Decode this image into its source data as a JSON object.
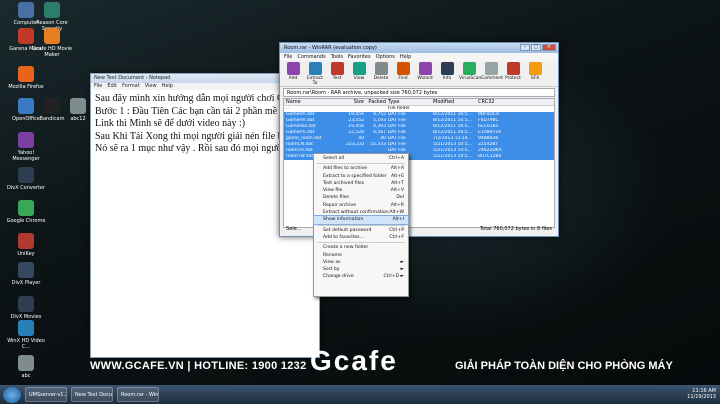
{
  "desktop_icons": [
    {
      "label": "Computer",
      "color": "#4a6fa5"
    },
    {
      "label": "Reason Core Security",
      "color": "#2e7d6b"
    },
    {
      "label": "Garena Menu",
      "color": "#c0392b"
    },
    {
      "label": "Gcafe HD Movie Maker",
      "color": "#e67e22"
    },
    {
      "label": "Mozilla Firefox",
      "color": "#e8641b"
    },
    {
      "label": "OpenOffice",
      "color": "#3a7ac0"
    },
    {
      "label": "Bandicam",
      "color": "#222222"
    },
    {
      "label": "abc12",
      "color": "#7f8c8d"
    },
    {
      "label": "Yahoo! Messenger",
      "color": "#7b3fa0"
    },
    {
      "label": "DivX Converter",
      "color": "#2c3e50"
    },
    {
      "label": "Google Chrome",
      "color": "#3aa757"
    },
    {
      "label": "UniKey",
      "color": "#b03a2e"
    },
    {
      "label": "DivX Player",
      "color": "#34495e"
    },
    {
      "label": "DivX Movies",
      "color": "#2c3e50"
    },
    {
      "label": "WinX HD Video C...",
      "color": "#2980b9"
    },
    {
      "label": "abc",
      "color": "#7f8c8d"
    }
  ],
  "banner": {
    "left": "WWW.GCAFE.VN  |  HOTLINE: 1900 1232",
    "right": "GIẢI PHÁP TOÀN DIỆN CHO PHÒNG MÁY",
    "brand": "Gcafe"
  },
  "notepad": {
    "title": "New Text Document - Notepad",
    "menu": [
      "File",
      "Edit",
      "Format",
      "View",
      "Help"
    ],
    "lines": [
      "Sau đây mình xin hướng dẫn mọi người chơi G",
      "Bước 1 : Đầu Tiên Các bạn cần tải 2 phần mề",
      "Link thì Mình sẽ để dưới video này :)",
      "Sau Khi Tải Xong thì mọi người giải nén file b",
      "Nó sẽ ra 1 mục như vậy . Rồi sau đó mọi người"
    ]
  },
  "winrar": {
    "title": "Room.rar - WinRAR (evaluation copy)",
    "menu": [
      "File",
      "Commands",
      "Tools",
      "Favorites",
      "Options",
      "Help"
    ],
    "toolbar": [
      {
        "label": "Add",
        "color": "#8e44ad"
      },
      {
        "label": "Extract To",
        "color": "#2980b9"
      },
      {
        "label": "Test",
        "color": "#c0392b"
      },
      {
        "label": "View",
        "color": "#16a085"
      },
      {
        "label": "Delete",
        "color": "#7f8c8d"
      },
      {
        "label": "Find",
        "color": "#d35400"
      },
      {
        "label": "Wizard",
        "color": "#8e44ad"
      },
      {
        "label": "Info",
        "color": "#2c3e50"
      },
      {
        "label": "VirusScan",
        "color": "#27ae60"
      },
      {
        "label": "Comment",
        "color": "#95a5a6"
      },
      {
        "label": "Protect",
        "color": "#c0392b"
      },
      {
        "label": "SFX",
        "color": "#f39c12"
      }
    ],
    "path": "Room.rar\\Room - RAR archive, unpacked size 760,072 bytes",
    "columns": [
      "Name",
      "Size",
      "Packed",
      "Type",
      "Modified",
      "CRC32"
    ],
    "rows": [
      {
        "name": "..",
        "size": "",
        "packed": "",
        "type": "File folder",
        "modified": "",
        "crc": "",
        "sel": false
      },
      {
        "name": "Gamerm.dat",
        "size": "19,456",
        "packed": "4,752",
        "type": "DAT File",
        "modified": "8/12/2011 16:5...",
        "crc": "9BF0DCA",
        "sel": true
      },
      {
        "name": "Gamerm.dat",
        "size": "23,552",
        "packed": "5,193",
        "type": "DAT File",
        "modified": "8/12/2011 16:5...",
        "crc": "F4D798C",
        "sel": true
      },
      {
        "name": "Gamerba.dat",
        "size": "19,456",
        "packed": "4,393",
        "type": "DAT File",
        "modified": "8/12/2011 16:5...",
        "crc": "6EC0185",
        "sel": true
      },
      {
        "name": "Gamerm.dat",
        "size": "22,528",
        "packed": "4,567",
        "type": "DAT File",
        "modified": "8/12/2011 16:5...",
        "crc": "E1A89729",
        "sel": true
      },
      {
        "name": "game_room.dat",
        "size": "40",
        "packed": "40",
        "type": "DAT File",
        "modified": "7/2/2013 13:14...",
        "crc": "9488B36",
        "sel": true
      },
      {
        "name": "roomCN.dat",
        "size": "223,232",
        "packed": "55,333",
        "type": "DAT File",
        "modified": "5/21/2013 10:5...",
        "crc": "2254287",
        "sel": true
      },
      {
        "name": "roomTH.dat",
        "size": "",
        "packed": "",
        "type": "DAT File",
        "modified": "5/21/2013 10:5...",
        "crc": "24622D6A",
        "sel": true
      },
      {
        "name": "roomTW.dat",
        "size": "",
        "packed": "",
        "type": "DAT File",
        "modified": "5/21/2013 10:5...",
        "crc": "B07C1284",
        "sel": true
      }
    ],
    "status_left": "Sele...",
    "status_right": "Total 760,072 bytes in 8 files"
  },
  "context_menu": [
    {
      "label": "Select all",
      "key": "Ctrl+A"
    },
    {
      "sep": true
    },
    {
      "label": "Add files to archive",
      "key": "Alt+A"
    },
    {
      "label": "Extract to a specified folder",
      "key": "Alt+E"
    },
    {
      "label": "Test archived files",
      "key": "Alt+T"
    },
    {
      "label": "View file",
      "key": "Alt+V"
    },
    {
      "label": "Delete files",
      "key": "Del"
    },
    {
      "label": "Repair archive",
      "key": "Alt+R"
    },
    {
      "label": "Extract without confirmation",
      "key": "Alt+W"
    },
    {
      "label": "Show information",
      "key": "Alt+I",
      "hl": true
    },
    {
      "sep": true
    },
    {
      "label": "Set default password",
      "key": "Ctrl+P"
    },
    {
      "label": "Add to favorites...",
      "key": "Ctrl+F"
    },
    {
      "sep": true
    },
    {
      "label": "Create a new folder",
      "key": ""
    },
    {
      "label": "Rename",
      "key": ""
    },
    {
      "label": "View as",
      "key": "►"
    },
    {
      "label": "Sort by",
      "key": "►"
    },
    {
      "label": "Change drive",
      "key": "Ctrl+D ►"
    }
  ],
  "taskbar": {
    "tasks": [
      "UMSserver-v1.202-9...",
      "New Text Document...",
      "Room.rar - WinRAR..."
    ],
    "time": "11:16 AM",
    "date": "11/19/2013"
  }
}
